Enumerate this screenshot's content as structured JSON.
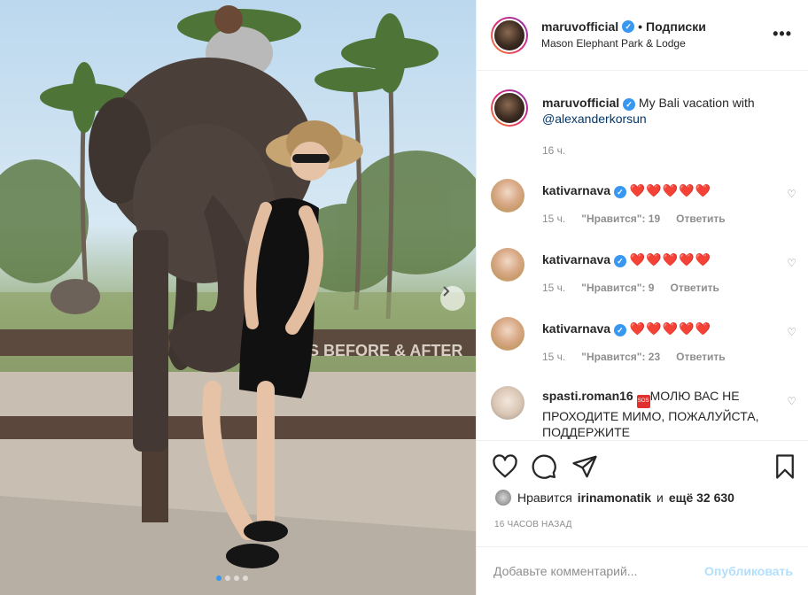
{
  "post": {
    "username": "maruvofficial",
    "follow_label": "Подписки",
    "separator": "•",
    "location": "Mason Elephant Park & Lodge",
    "more_label": "•••",
    "sign_text": "S BEFORE & AFTER"
  },
  "caption": {
    "username": "maruvofficial",
    "text": "My Bali vacation with",
    "mention": "@alexanderkorsun",
    "time": "16 ч."
  },
  "comments": [
    {
      "username": "kativarnava",
      "text": "❤️❤️❤️❤️❤️",
      "time": "15 ч.",
      "likes": "\"Нравится\": 19",
      "reply": "Ответить"
    },
    {
      "username": "kativarnava",
      "text": "❤️❤️❤️❤️❤️",
      "time": "15 ч.",
      "likes": "\"Нравится\": 9",
      "reply": "Ответить"
    },
    {
      "username": "kativarnava",
      "text": "❤️❤️❤️❤️❤️",
      "time": "15 ч.",
      "likes": "\"Нравится\": 23",
      "reply": "Ответить"
    },
    {
      "username": "spasti.roman16",
      "badge": "SOS",
      "text": "МОЛЮ ВАС НЕ ПРОХОДИТЕ МИМО, ПОЖАЛУЙСТА, ПОДДЕРЖИТЕ"
    }
  ],
  "likes": {
    "prefix": "Нравится",
    "user": "irinamonatik",
    "middle": "и",
    "count": "ещё 32 630"
  },
  "time_ago": "16 ЧАСОВ НАЗАД",
  "add_comment": {
    "placeholder": "Добавьте комментарий...",
    "post_label": "Опубликовать"
  },
  "colors": {
    "accent_blue": "#3897f0",
    "heart_red": "#ed4956",
    "muted": "#8e8e8e",
    "post_disabled": "#b2dffc"
  },
  "carousel": {
    "dots": 4,
    "active_index": 0
  }
}
